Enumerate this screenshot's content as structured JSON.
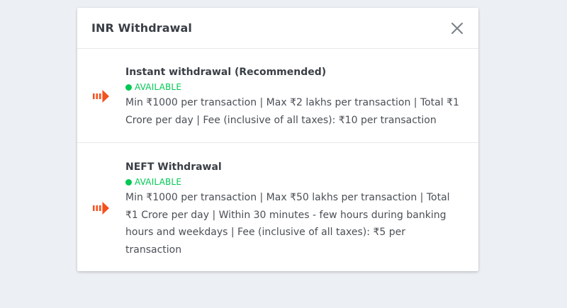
{
  "modal": {
    "title": "INR Withdrawal",
    "close_icon": "close-icon"
  },
  "options": [
    {
      "title": "Instant withdrawal (Recommended)",
      "status": "AVAILABLE",
      "description": "Min ₹1000 per transaction | Max ₹2 lakhs per transaction | Total ₹1 Crore per day | Fee (inclusive of all taxes): ₹10 per transaction",
      "icon": "arrow-icon"
    },
    {
      "title": "NEFT Withdrawal",
      "status": "AVAILABLE",
      "description": "Min ₹1000 per transaction | Max ₹50 lakhs per transaction | Total ₹1 Crore per day | Within 30 minutes - few hours during banking hours and weekdays | Fee (inclusive of all taxes): ₹5 per transaction",
      "icon": "arrow-icon"
    }
  ],
  "colors": {
    "available": "#00c853",
    "arrow": "#f4511e",
    "title": "#3a3f46",
    "text": "#4a4f56",
    "background": "#eceff3"
  }
}
